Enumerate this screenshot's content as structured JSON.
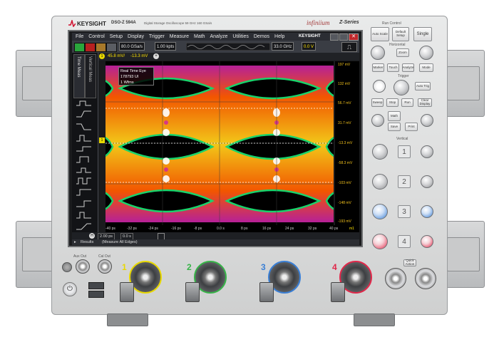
{
  "brand": {
    "logo_text": "KEYSIGHT",
    "model": "DSO-Z 594A",
    "model_desc": "Digital Storage Oscilloscope  59 GHz  160 GSa/s",
    "series_script": "infiniium",
    "series": "Z-Series",
    "screen_logo": "KEYSIGHT"
  },
  "menu": [
    "File",
    "Control",
    "Setup",
    "Display",
    "Trigger",
    "Measure",
    "Math",
    "Analyze",
    "Utilities",
    "Demos",
    "Help"
  ],
  "toolbar": {
    "sample_rate": "80.0 GSa/s",
    "memory": "1.00 kpts",
    "bandwidth": "33.0 GHz",
    "trigger_level": "0.0 V"
  },
  "measure_row": {
    "scale": "45.8 mV/",
    "offset": "-13.3 mV"
  },
  "left_tabs": [
    "Time Meas",
    "Vertical Meas"
  ],
  "eye_label": {
    "title": "Real Time Eye",
    "count": "178793 UI",
    "waveforms": "1 Wfms"
  },
  "y_labels": [
    "197 mV",
    "132 mV",
    "56.7 mV",
    "31.7 mV",
    "-13.3 mV",
    "-58.3 mV",
    "-103 mV",
    "-148 mV",
    "-193 mV"
  ],
  "x_labels": [
    "-40 ps",
    "-32 ps",
    "-24 ps",
    "-16 ps",
    "-8 ps",
    "0.0 s",
    "8 ps",
    "16 ps",
    "24 ps",
    "32 ps",
    "40 ps"
  ],
  "x_unit": "m1",
  "horizontal": {
    "timebase": "2.00 ps",
    "position": "0.0 s"
  },
  "results": {
    "label": "Results",
    "value": "(Measure All Edges)"
  },
  "panel": {
    "run_control": "Run Control",
    "auto_scale": "Auto Scale",
    "default_setup": "Default Setup",
    "single": "Single",
    "horizontal": "Horizontal",
    "zoom": "Zoom",
    "trigger": "Trigger",
    "vertical": "Vertical",
    "marker": "Marker",
    "touch": "Touch",
    "analyze": "Analyze",
    "auto_trig": "Auto Trig",
    "sweep": "Sweep",
    "mode": "Mode",
    "stop": "Stop",
    "run": "Run",
    "clear_display": "Clear Display",
    "math": "Math",
    "save": "Save",
    "print": "Print",
    "quick_action": "Quick Action",
    "aux_out": "Aux Out",
    "cal_out": "Cal Out",
    "power": "Power"
  },
  "channels": [
    "1",
    "2",
    "3",
    "4"
  ],
  "channel_colors": [
    "#e8d800",
    "#38b449",
    "#3a7fd5",
    "#e0284a"
  ]
}
